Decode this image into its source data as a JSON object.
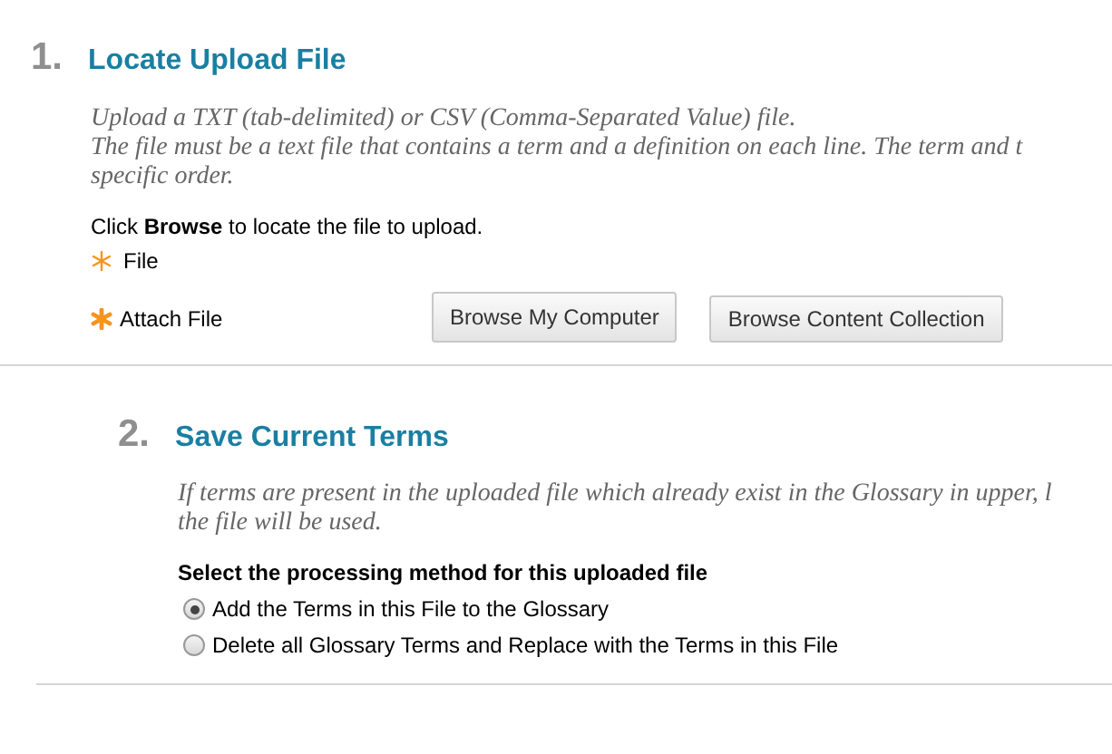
{
  "steps": [
    {
      "number": "1.",
      "title": "Locate Upload File",
      "description": [
        "Upload a TXT (tab-delimited) or CSV (Comma-Separated Value) file.",
        "The file must be a text file that contains a term and a definition on each line. The term and t",
        "specific order."
      ],
      "kind": "upload",
      "instruction": "Click **Browse** to locate the file to upload.",
      "legend": "File",
      "field_label": "Attach File",
      "buttons": [
        "Browse My Computer",
        "Browse Content Collection"
      ]
    },
    {
      "number": "2.",
      "title": "Save Current Terms",
      "description": [
        "If terms are present in the uploaded file which already exist in the Glossary in upper, l",
        "the file will be used."
      ],
      "kind": "options",
      "question": "Select the processing method for this uploaded file",
      "options": [
        {
          "label": "Add the Terms in this File to the Glossary",
          "selected": true
        },
        {
          "label": "Delete all Glossary Terms and Replace with the Terms in this File",
          "selected": false
        }
      ]
    }
  ]
}
